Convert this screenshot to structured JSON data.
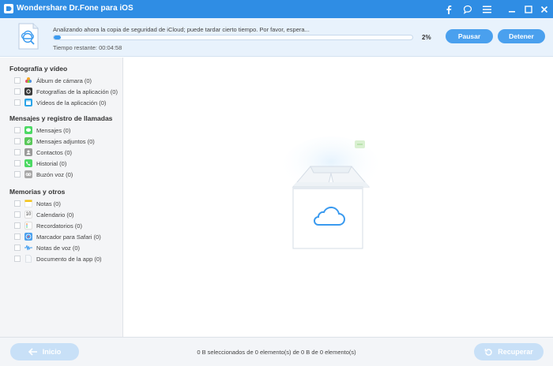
{
  "window": {
    "title": "Wondershare Dr.Fone para iOS"
  },
  "titlebar_icons": [
    "facebook-icon",
    "feedback-icon",
    "menu-icon",
    "minimize-icon",
    "maximize-icon",
    "close-icon"
  ],
  "scan": {
    "status": "Analizando ahora la copia de seguridad de iCloud; puede tardar cierto tiempo. Por favor, espera...",
    "progress_percent": 2,
    "progress_label": "2%",
    "time_remaining": "Tiempo restante: 00:04:58",
    "pause_label": "Pausar",
    "stop_label": "Detener"
  },
  "sidebar": {
    "sections": [
      {
        "title": "Fotografía y vídeo",
        "items": [
          {
            "label": "Álbum de cámara (0)",
            "icon": "photos-icon"
          },
          {
            "label": "Fotografías de la aplicación (0)",
            "icon": "camera-icon"
          },
          {
            "label": "Vídeos de la aplicación (0)",
            "icon": "clapper-icon"
          }
        ]
      },
      {
        "title": "Mensajes y registro de llamadas",
        "items": [
          {
            "label": "Mensajes (0)",
            "icon": "messages-icon"
          },
          {
            "label": "Mensajes adjuntos (0)",
            "icon": "attachment-icon"
          },
          {
            "label": "Contactos (0)",
            "icon": "contacts-icon"
          },
          {
            "label": "Historial (0)",
            "icon": "phone-icon"
          },
          {
            "label": "Buzón voz (0)",
            "icon": "voicemail-icon"
          }
        ]
      },
      {
        "title": "Memorias y otros",
        "items": [
          {
            "label": "Notas (0)",
            "icon": "notes-icon"
          },
          {
            "label": "Calendario (0)",
            "icon": "calendar-icon"
          },
          {
            "label": "Recordatorios (0)",
            "icon": "reminders-icon"
          },
          {
            "label": "Marcador para Safari (0)",
            "icon": "safari-icon"
          },
          {
            "label": "Notas de voz (0)",
            "icon": "voice-memo-icon"
          },
          {
            "label": "Documento de la app (0)",
            "icon": "document-icon"
          }
        ]
      }
    ]
  },
  "calendar_icon_text": "10",
  "footer": {
    "back_label": "Inicio",
    "summary": "0 B seleccionados de 0 elemento(s) de 0 B de 0 elemento(s)",
    "recover_label": "Recuperar"
  },
  "colors": {
    "titlebar": "#2f8de4",
    "accent": "#4aa0ee",
    "progress_fill": "#3a9aef",
    "disabled_button": "#c8e0f7"
  }
}
